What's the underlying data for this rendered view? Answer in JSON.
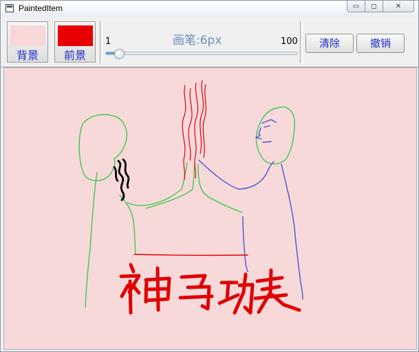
{
  "window": {
    "title": "PaintedItem",
    "controls": {
      "minimize": "▭",
      "maximize": "◻",
      "close": "✕"
    }
  },
  "toolbar": {
    "background_label": "背景",
    "foreground_label": "前景",
    "background_color": "#f7d7d8",
    "foreground_color": "#e80000",
    "pen_label": "画笔:6px",
    "slider_min": "1",
    "slider_max": "100",
    "pen_width_value": 6,
    "clear_label": "清除",
    "undo_label": "撤销"
  },
  "canvas": {
    "background_color": "#f7d9da",
    "stroke_colors": {
      "green": "#3cc94a",
      "blue": "#4a52d8",
      "red": "#e00000",
      "black": "#000000"
    }
  }
}
